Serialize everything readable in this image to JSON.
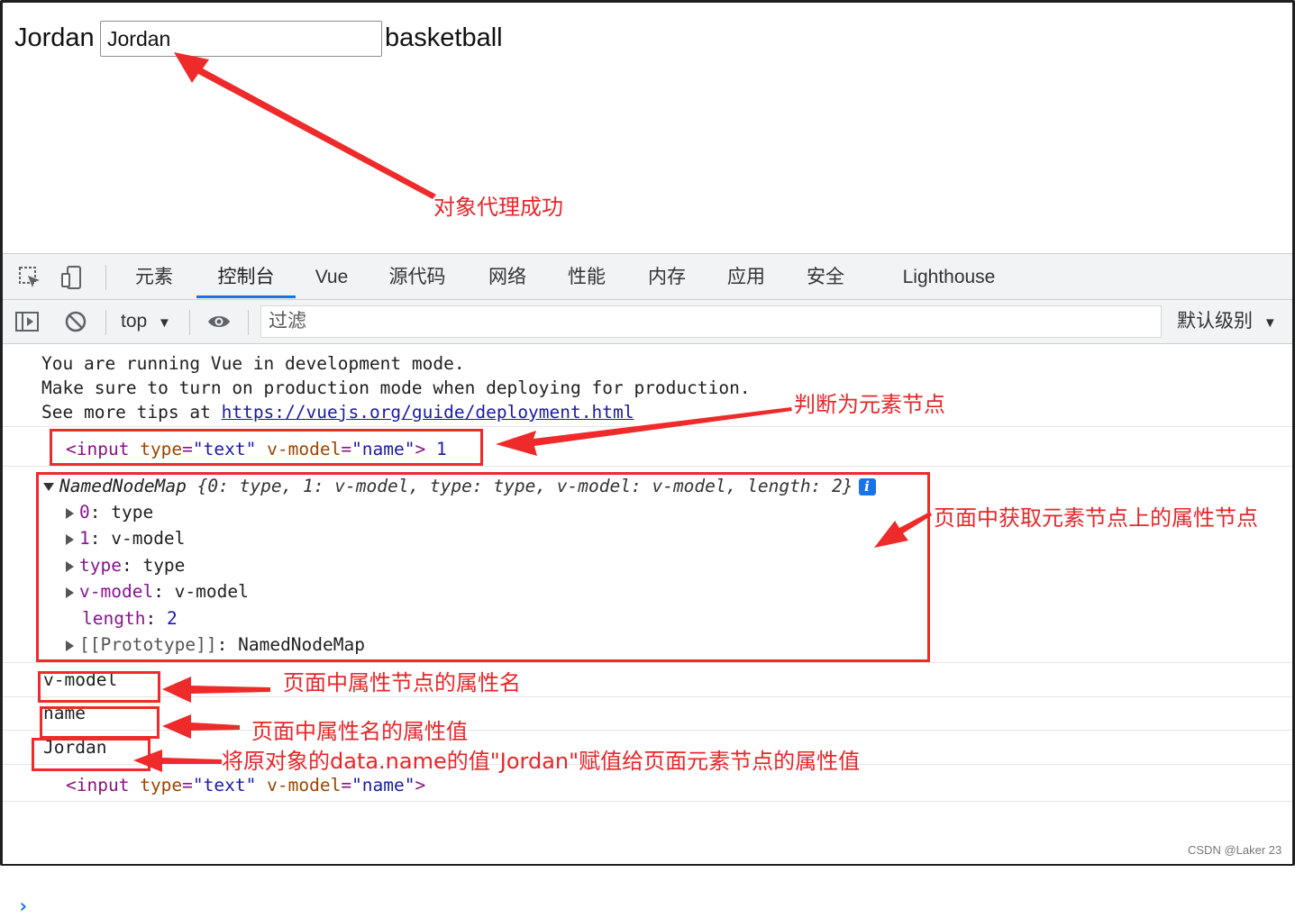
{
  "page": {
    "label_before": "Jordan",
    "input_value": "Jordan",
    "label_after": "basketball"
  },
  "devtools": {
    "tabs": [
      "元素",
      "控制台",
      "Vue",
      "源代码",
      "网络",
      "性能",
      "内存",
      "应用",
      "安全",
      "Lighthouse"
    ],
    "active_tab": "控制台",
    "context_selector": "top",
    "filter_placeholder": "过滤",
    "log_levels": "默认级别"
  },
  "console": {
    "vue_notice": {
      "line1": "You are running Vue in development mode.",
      "line2": "Make sure to turn on production mode when deploying for production.",
      "line3_prefix": "See more tips at ",
      "line3_link": "https://vuejs.org/guide/deployment.html"
    },
    "element_log": {
      "tag_open": "<input",
      "attr1_name": "type",
      "attr1_value": "\"text\"",
      "attr2_name": "v-model",
      "attr2_value": "\"name\"",
      "tag_close": ">",
      "count": "1"
    },
    "named_node_map": {
      "summary_name": "NamedNodeMap",
      "summary_body": "{0: type, 1: v-model, type: type, v-model: v-model, length: 2}",
      "entries": [
        {
          "key": "0",
          "value": "type"
        },
        {
          "key": "1",
          "value": "v-model"
        },
        {
          "key": "type",
          "value": "type"
        },
        {
          "key": "v-model",
          "value": "v-model"
        }
      ],
      "length_label": "length",
      "length_value": "2",
      "prototype_key": "[[Prototype]]",
      "prototype_value": "NamedNodeMap"
    },
    "log_attr_name": "v-model",
    "log_attr_value": "name",
    "log_data_value": "Jordan",
    "final_element_log": {
      "tag_open": "<input",
      "attr1_name": "type",
      "attr1_value": "\"text\"",
      "attr2_name": "v-model",
      "attr2_value": "\"name\"",
      "tag_close": ">"
    }
  },
  "annotations": {
    "proxy_success": "对象代理成功",
    "is_element_node": "判断为元素节点",
    "get_attr_nodes": "页面中获取元素节点上的属性节点",
    "attr_name": "页面中属性节点的属性名",
    "attr_value": "页面中属性名的属性值",
    "assign_value": "将原对象的data.name的值\"Jordan\"赋值给页面元素节点的属性值"
  },
  "watermark": "CSDN @Laker 23",
  "colors": {
    "annotation_red": "#ee2a2a",
    "active_tab_blue": "#1a73e8",
    "devtools_toolbar_bg": "#f1f3f4"
  },
  "icons": [
    "inspect-element-icon",
    "device-toolbar-icon",
    "sidebar-toggle-icon",
    "clear-console-icon",
    "eye-icon",
    "dropdown-caret-icon",
    "info-icon",
    "prompt-chevron-icon"
  ]
}
